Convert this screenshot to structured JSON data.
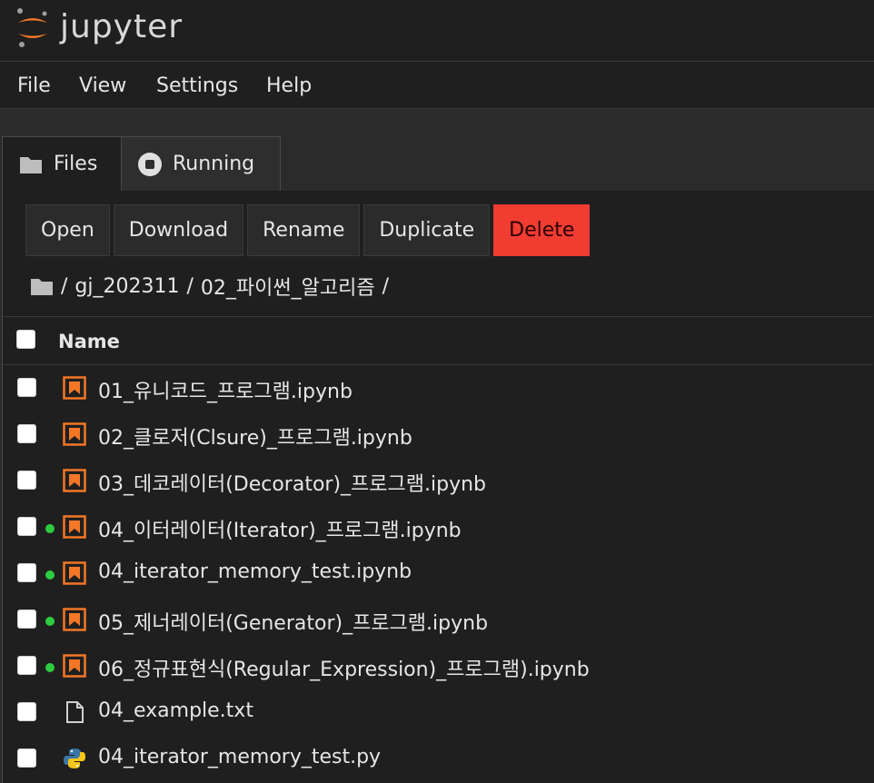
{
  "app": {
    "logo_text": "jupyter"
  },
  "menu": {
    "items": [
      "File",
      "View",
      "Settings",
      "Help"
    ]
  },
  "tabs": [
    {
      "label": "Files",
      "icon": "folder-icon",
      "active": true
    },
    {
      "label": "Running",
      "icon": "stop-circle-icon",
      "active": false
    }
  ],
  "toolbar": {
    "open": "Open",
    "download": "Download",
    "rename": "Rename",
    "duplicate": "Duplicate",
    "delete": "Delete"
  },
  "breadcrumb": {
    "root": "/",
    "parts": [
      "gj_202311",
      "02_파이썬_알고리즘"
    ],
    "separator": "/"
  },
  "table": {
    "name_header": "Name"
  },
  "files": [
    {
      "name": "01_유니코드_프로그램.ipynb",
      "type": "notebook",
      "running": false
    },
    {
      "name": "02_클로저(Clsure)_프로그램.ipynb",
      "type": "notebook",
      "running": false
    },
    {
      "name": "03_데코레이터(Decorator)_프로그램.ipynb",
      "type": "notebook",
      "running": false
    },
    {
      "name": "04_이터레이터(Iterator)_프로그램.ipynb",
      "type": "notebook",
      "running": true
    },
    {
      "name": "04_iterator_memory_test.ipynb",
      "type": "notebook",
      "running": true
    },
    {
      "name": "05_제너레이터(Generator)_프로그램.ipynb",
      "type": "notebook",
      "running": true
    },
    {
      "name": "06_정규표현식(Regular_Expression)_프로그램).ipynb",
      "type": "notebook",
      "running": true
    },
    {
      "name": "04_example.txt",
      "type": "text",
      "running": false
    },
    {
      "name": "04_iterator_memory_test.py",
      "type": "python",
      "running": false
    }
  ],
  "colors": {
    "accent_orange": "#f37726",
    "running_green": "#2ecc40",
    "delete_red": "#f13c32"
  }
}
